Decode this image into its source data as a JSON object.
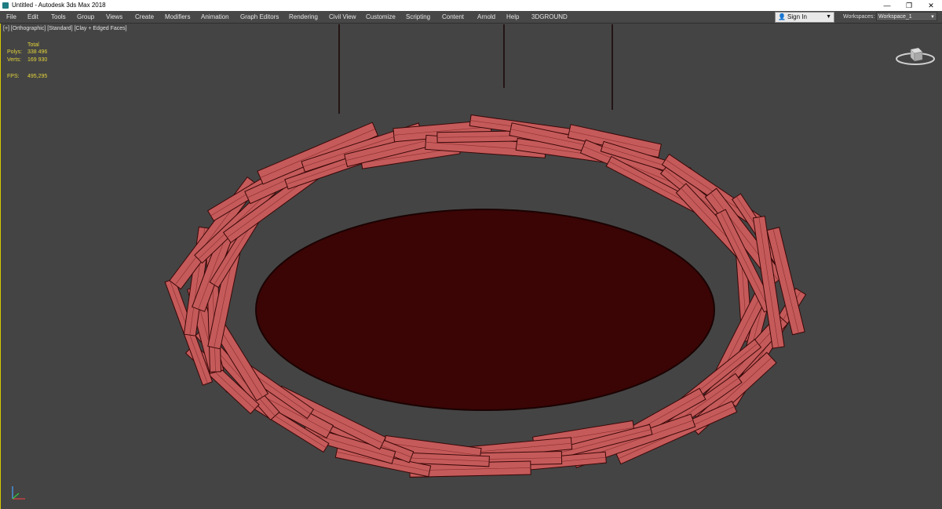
{
  "window": {
    "title": "Untitled - Autodesk 3ds Max 2018",
    "minimize_glyph": "—",
    "maximize_glyph": "❐",
    "close_glyph": "✕"
  },
  "menu": {
    "items": [
      "File",
      "Edit",
      "Tools",
      "Group",
      "Views",
      "Create",
      "Modifiers",
      "Animation",
      "Graph Editors",
      "Rendering",
      "Civil View",
      "Customize",
      "Scripting",
      "Content",
      "Arnold",
      "Help",
      "3DGROUND"
    ],
    "sign_in": "Sign In",
    "workspaces_label": "Workspaces:",
    "workspace_value": "Workspace_1"
  },
  "viewport": {
    "label": "[+] [Orthographic] [Standard] [Clay + Edged Faces]",
    "stats": {
      "total_label": "Total",
      "polys_label": "Polys:",
      "polys_value": "338 496",
      "verts_label": "Verts:",
      "verts_value": "169 930",
      "fps_label": "FPS:",
      "fps_value": "495,295"
    }
  },
  "icons": {
    "app": "3ds-max-app-icon",
    "user": "user-icon",
    "dropdown": "chevron-down-icon",
    "viewcube": "viewcube-icon",
    "axis": "axis-gizmo-icon"
  },
  "colors": {
    "viewport_bg": "#444444",
    "stats_text": "#e3d43a",
    "plank_fill": "#c55a5a",
    "plank_edge": "#3a0808",
    "interior": "#3b0505",
    "active_border": "#d7c900"
  }
}
